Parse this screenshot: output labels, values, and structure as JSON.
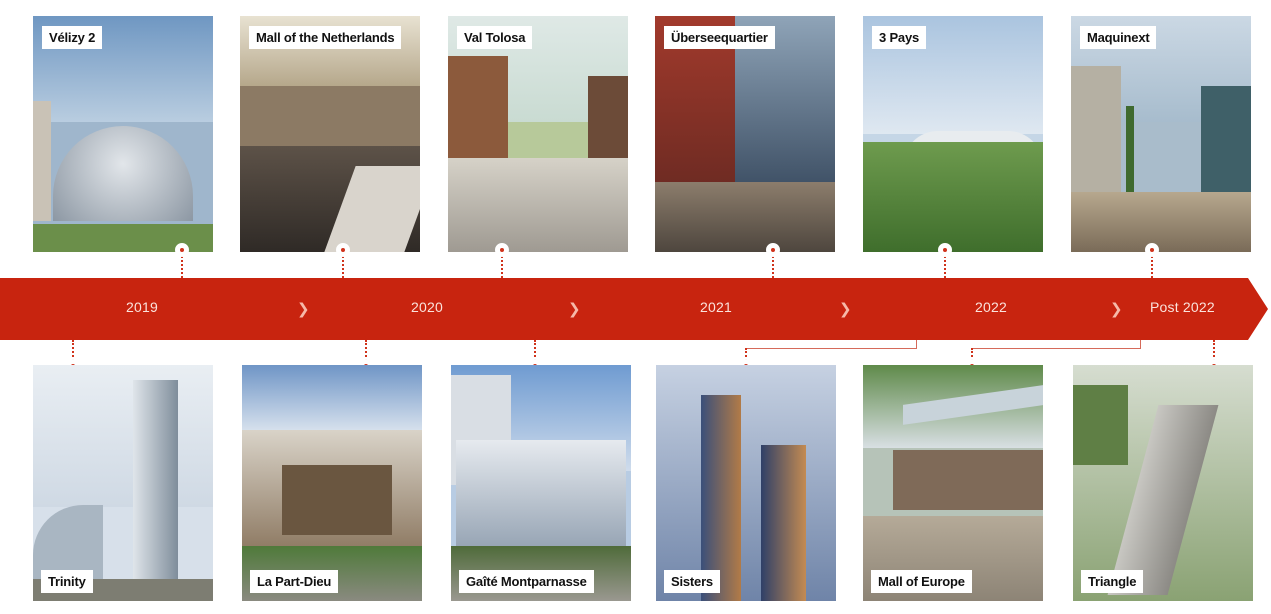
{
  "timeline": {
    "years": [
      "2019",
      "2020",
      "2021",
      "2022",
      "Post 2022"
    ],
    "accent_color": "#c8240f"
  },
  "projects_top": [
    {
      "name": "Vélizy 2"
    },
    {
      "name": "Mall of the Netherlands"
    },
    {
      "name": "Val Tolosa"
    },
    {
      "name": "Überseequartier"
    },
    {
      "name": "3 Pays"
    },
    {
      "name": "Maquinext"
    }
  ],
  "projects_bottom": [
    {
      "name": "Trinity"
    },
    {
      "name": "La Part-Dieu"
    },
    {
      "name": "Gaîté Montparnasse"
    },
    {
      "name": "Sisters"
    },
    {
      "name": "Mall of Europe"
    },
    {
      "name": "Triangle"
    }
  ]
}
